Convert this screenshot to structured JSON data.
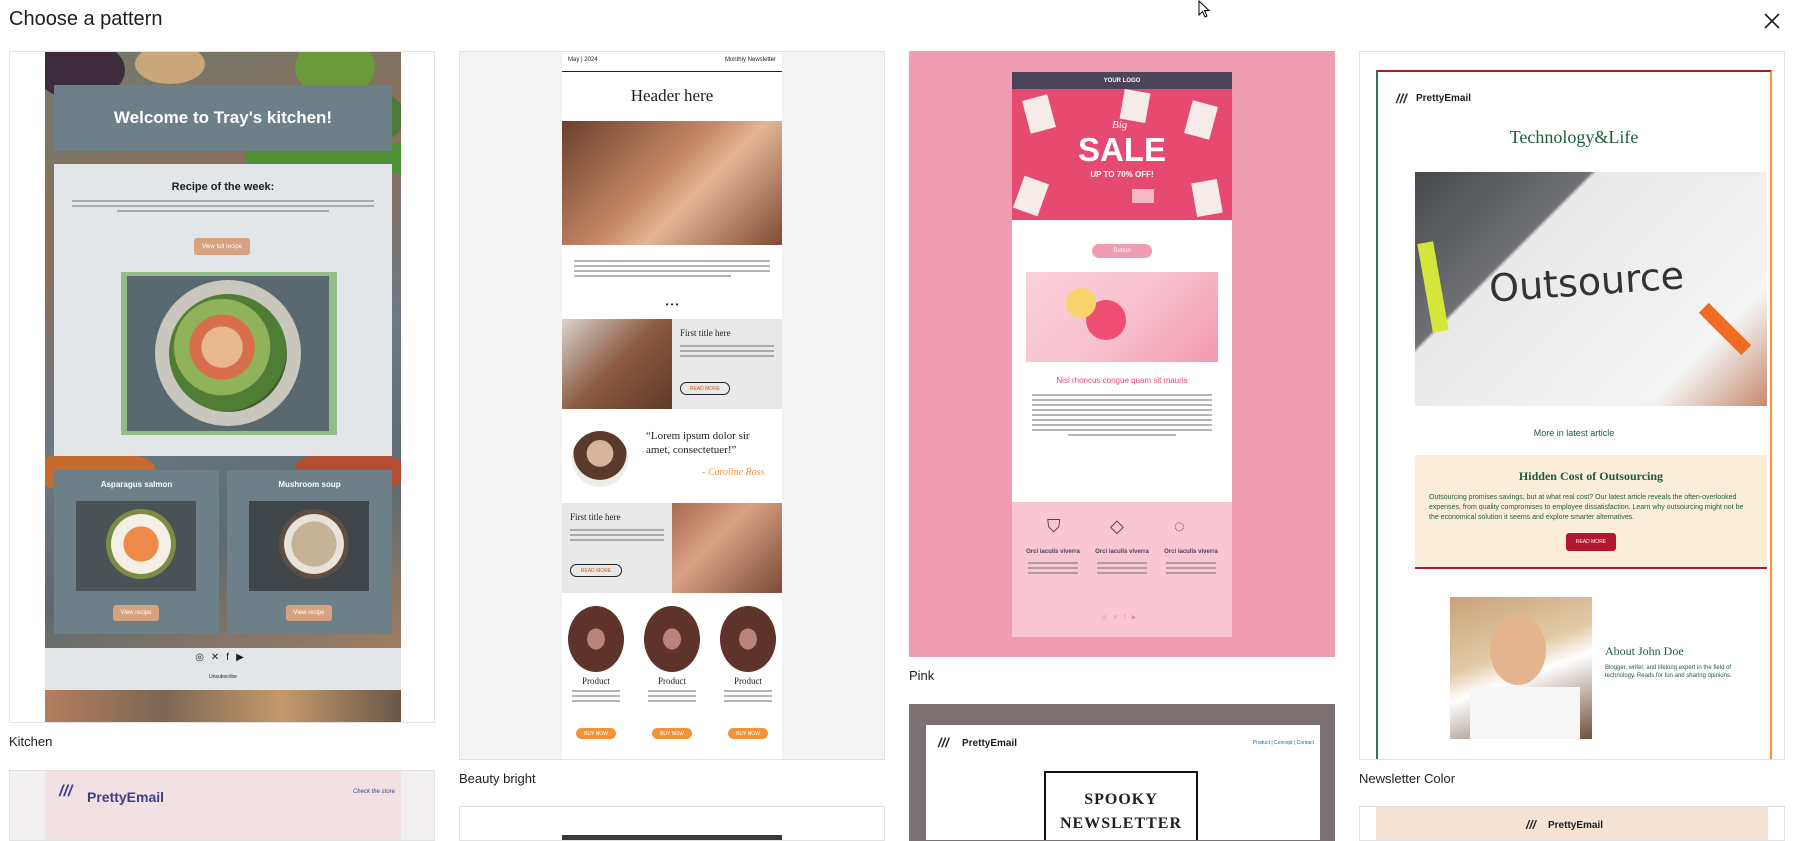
{
  "dialog": {
    "title": "Choose a pattern"
  },
  "patterns": {
    "kitchen": {
      "caption": "Kitchen",
      "hero": "Welcome to Tray's kitchen!",
      "recipe_title": "Recipe of the week:",
      "recipe_button": "View full recipe",
      "item1": "Asparagus salmon",
      "item2": "Mushroom soup",
      "item_button": "View recipe",
      "footer_link": "Unsubscribe"
    },
    "beauty": {
      "caption": "Beauty bright",
      "date": "May | 2024",
      "newsletter": "Monthly Newsletter",
      "header": "Header here",
      "first_title": "First title here",
      "read_more": "READ MORE",
      "quote": "“Lorem ipsum dolor sir amet, consectetuer!”",
      "signature": "- Caroline Ross",
      "product": "Product",
      "buy_now": "BUY NOW"
    },
    "pink": {
      "caption": "Pink",
      "logo": "YOUR LOGO",
      "sale_small": "Big",
      "sale": "SALE",
      "sale_sub": "UP TO 70% OFF!",
      "button": "Button",
      "headline": "Nisl rhoncus congue quam sit mauris",
      "feature": "Orci iaculis viverra"
    },
    "newsletter_color": {
      "caption": "Newsletter Color",
      "brand": "PrettyEmail",
      "title": "Technology&Life",
      "photo_word": "Outsource",
      "more": "More in latest article",
      "box_title": "Hidden Cost of Outsourcing",
      "box_text": "Outsourcing promises savings, but at what real cost? Our latest article reveals the often-overlooked expenses, from quality compromises to employee dissatisfaction. Learn why outsourcing might not be the economical solution it seems and explore smarter alternatives.",
      "read_more": "READ MORE",
      "about": "About John Doe",
      "about_text": "Blogger, writer, and lifelong expert in the field of technology. Reads for fun and sharing opinions."
    },
    "spooky": {
      "brand": "PrettyEmail",
      "links": "Product | Concept | Contact",
      "title_line1": "SPOOKY",
      "title_line2": "NEWSLETTER"
    },
    "pretty_pink": {
      "brand": "PrettyEmail",
      "link": "Check the store"
    },
    "pretty_beige": {
      "brand": "PrettyEmail"
    }
  },
  "colors": {
    "pink_bg": "#f09db3",
    "slate": "#6d7f87",
    "salmon": "#d7a27f",
    "orange": "#f39237",
    "crimson": "#b3172f"
  }
}
